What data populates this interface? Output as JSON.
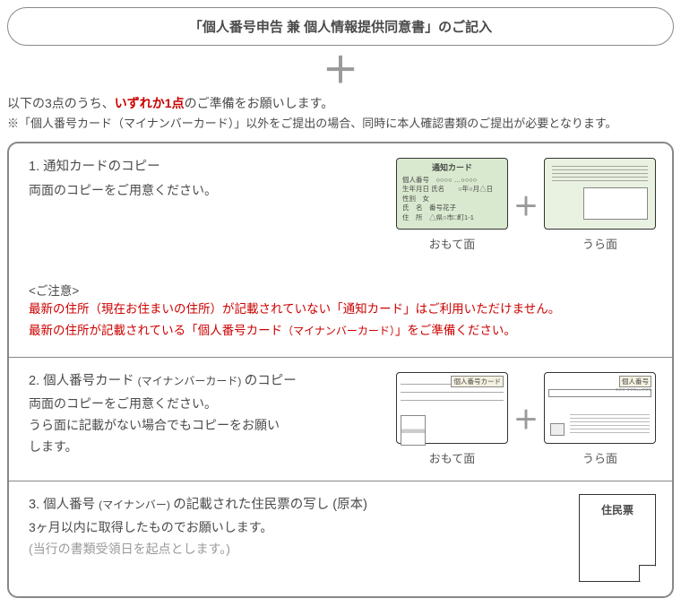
{
  "pill": "「個人番号申告 兼 個人情報提供同意書」のご記入",
  "plus": "＋",
  "intro_pre": "以下の3点のうち、",
  "intro_red": "いずれか1点",
  "intro_post": "のご準備をお願いします。",
  "note": "※「個人番号カード（マイナンバーカード）」以外をご提出の場合、同時に本人確認書類のご提出が必要となります。",
  "s1": {
    "title": "1. 通知カードのコピー",
    "sub": " 両面のコピーをご用意ください。",
    "front_label": "おもて面",
    "back_label": "うら面",
    "caution_head": "<ご注意>",
    "caution1": "最新の住所（現在お住まいの住所）が記載されていない「通知カード」はご利用いただけません。",
    "caution2_a": "最新の住所が記載されている「個人番号カード",
    "caution2_b": "（マイナンバーカード）",
    "caution2_c": "」をご準備ください。",
    "card_title": "通知カード",
    "card_line1": "個人番号　○○○○ …○○○○",
    "card_line2": "氏名　　○年○月△日",
    "card_line3": "生年月日",
    "card_line4": "性別　女",
    "card_line5": "氏　名　番号花子",
    "card_line6": "住　所　△県○市□町1-1"
  },
  "s2": {
    "title_a": "2. 個人番号カード ",
    "title_b": "(マイナンバーカード) ",
    "title_c": "のコピー",
    "sub1": "両面のコピーをご用意ください。",
    "sub2": "うら面に記載がない場合でもコピーをお願い",
    "sub3": "します。",
    "front_label": "おもて面",
    "back_label": "うら面",
    "tag_front": "個人番号カード",
    "tag_back": "個人番号",
    "num": "○○○ ○○○…○○○"
  },
  "s3": {
    "title_a": "3. 個人番号 ",
    "title_b": "(マイナンバー) ",
    "title_c": "の記載された住民票の写し (原本)",
    "sub1": "3ヶ月以内に取得したものでお願いします。",
    "sub2": "(当行の書類受領日を起点とします。)",
    "doc_title": "住民票"
  }
}
